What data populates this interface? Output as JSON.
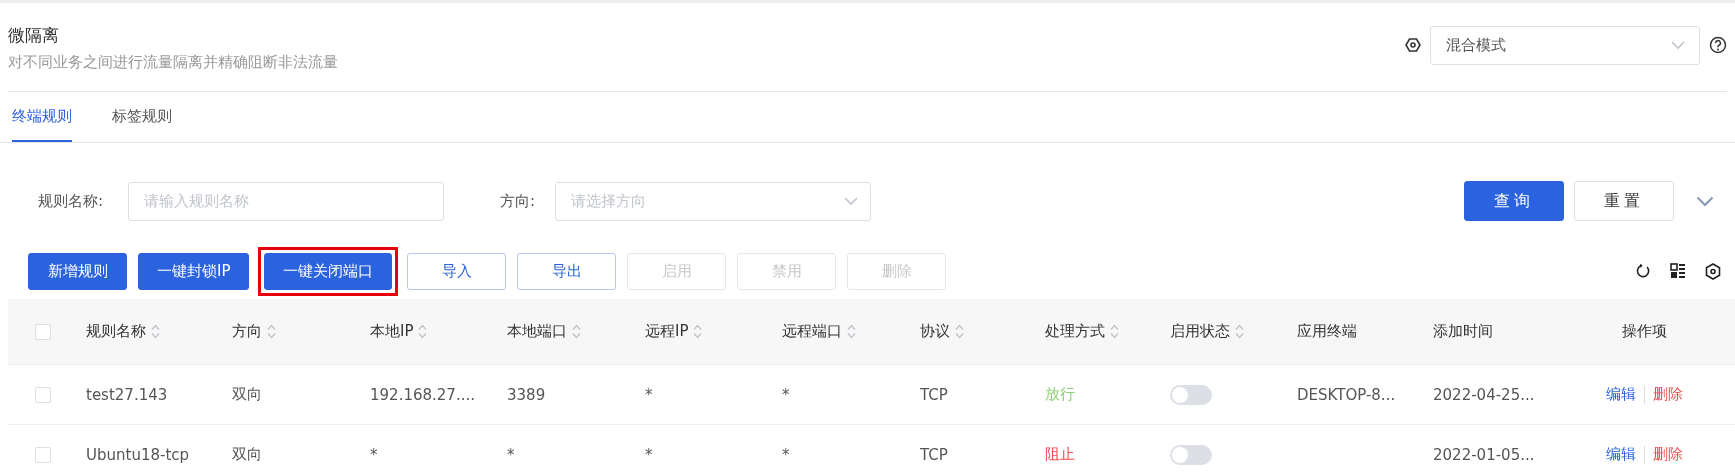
{
  "header": {
    "title": "微隔离",
    "subtitle": "对不同业务之间进行流量隔离并精确阻断非法流量",
    "mode_select": {
      "value": "混合模式"
    }
  },
  "tabs": [
    {
      "label": "终端规则",
      "selected": true
    },
    {
      "label": "标签规则",
      "selected": false
    }
  ],
  "filters": [
    {
      "label": "规则名称:",
      "kind": "input",
      "placeholder": "请输入规则名称"
    },
    {
      "label": "方向:",
      "kind": "select",
      "placeholder": "请选择方向"
    }
  ],
  "filter_buttons": [
    {
      "label": "查询",
      "kind": "primary"
    },
    {
      "label": "重置",
      "kind": "default"
    }
  ],
  "toolbar": [
    {
      "label": "新增规则",
      "kind": "primary",
      "disabled": false,
      "highlighted": false
    },
    {
      "label": "一键封锁IP",
      "kind": "primary",
      "disabled": false,
      "highlighted": false
    },
    {
      "label": "一键关闭端口",
      "kind": "primary",
      "disabled": false,
      "highlighted": true
    },
    {
      "label": "导入",
      "kind": "plain",
      "disabled": false,
      "highlighted": false
    },
    {
      "label": "导出",
      "kind": "plain",
      "disabled": false,
      "highlighted": false
    },
    {
      "label": "启用",
      "kind": "plain",
      "disabled": true,
      "highlighted": false
    },
    {
      "label": "禁用",
      "kind": "plain",
      "disabled": true,
      "highlighted": false
    },
    {
      "label": "删除",
      "kind": "plain",
      "disabled": true,
      "highlighted": false
    }
  ],
  "table": {
    "select_all": {
      "checked": false
    },
    "columns": [
      {
        "label": "规则名称",
        "sortable": true
      },
      {
        "label": "方向",
        "sortable": true
      },
      {
        "label": "本地IP",
        "sortable": true
      },
      {
        "label": "本地端口",
        "sortable": true
      },
      {
        "label": "远程IP",
        "sortable": true
      },
      {
        "label": "远程端口",
        "sortable": true
      },
      {
        "label": "协议",
        "sortable": true
      },
      {
        "label": "处理方式",
        "sortable": true
      },
      {
        "label": "启用状态",
        "sortable": true
      },
      {
        "label": "应用终端",
        "sortable": false
      },
      {
        "label": "添加时间",
        "sortable": false
      },
      {
        "label": "操作项",
        "sortable": false
      }
    ],
    "rows": [
      {
        "checked": false,
        "name": "test27.143",
        "direction": "双向",
        "local_ip": "192.168.27....",
        "local_port": "3389",
        "remote_ip": "*",
        "remote_port": "*",
        "protocol": "TCP",
        "action": {
          "text": "放行",
          "kind": "allow"
        },
        "enabled": {
          "on": false
        },
        "terminal": "DESKTOP-8...",
        "added": "2022-04-25...",
        "ops": [
          "编辑",
          "删除"
        ]
      },
      {
        "checked": false,
        "name": "Ubuntu18-tcp",
        "direction": "双向",
        "local_ip": "*",
        "local_port": "*",
        "remote_ip": "*",
        "remote_port": "*",
        "protocol": "TCP",
        "action": {
          "text": "阻止",
          "kind": "block"
        },
        "enabled": {
          "on": false
        },
        "added": "2022-01-05...",
        "ops": [
          "编辑",
          "删除"
        ]
      }
    ]
  }
}
